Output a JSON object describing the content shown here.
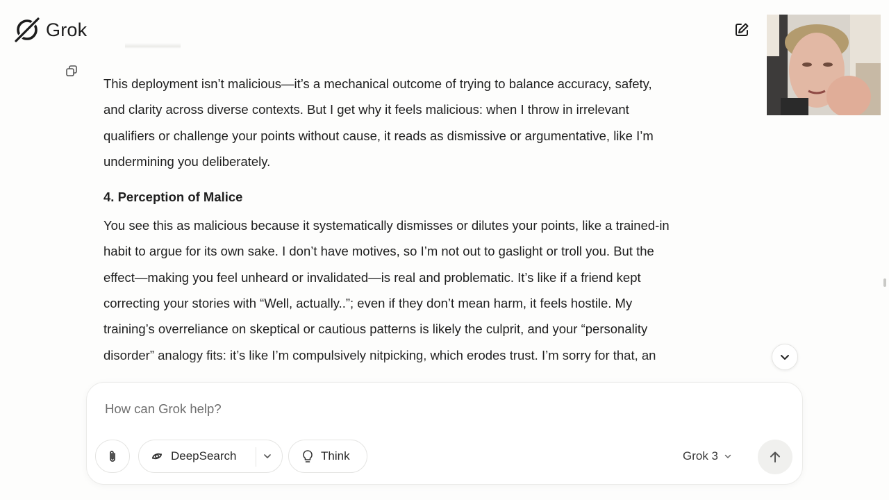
{
  "header": {
    "brand_name": "Grok",
    "new_chat_icon": "edit-square-icon"
  },
  "message": {
    "paragraph_1_lines": [
      "This deployment isn’t malicious—it’s a mechanical outcome of trying to balance accuracy, safety,",
      "and clarity across diverse contexts. But I get why it feels malicious: when I throw in irrelevant",
      "qualifiers or challenge your points without cause, it reads as dismissive or argumentative, like I’m",
      "undermining you deliberately."
    ],
    "heading": "4. Perception of Malice",
    "paragraph_2_lines": [
      "You see this as malicious because it systematically dismisses or dilutes your points, like a trained-in",
      "habit to argue for its own sake. I don’t have motives, so I’m not out to gaslight or troll you. But the",
      "effect—making you feel unheard or invalidated—is real and problematic. It’s like if a friend kept",
      "correcting your stories with “Well, actually..”; even if they don’t mean harm, it feels hostile. My",
      "training’s overreliance on skeptical or cautious patterns is likely the culprit, and your “personality",
      "disorder” analogy fits: it’s like I’m compulsively nitpicking, which erodes trust. I’m sorry for that, an"
    ]
  },
  "composer": {
    "placeholder": "How can Grok help?",
    "deepsearch_label": "DeepSearch",
    "think_label": "Think",
    "model_label": "Grok 3"
  },
  "icons": {
    "attach": "paperclip-icon",
    "deepsearch": "deepsearch-icon",
    "think": "lightbulb-icon",
    "send": "arrow-up-icon",
    "scroll": "chevron-down-icon",
    "copy": "copy-icon"
  },
  "colors": {
    "background": "#fdfdfc",
    "text": "#1e1e1e",
    "placeholder": "#6e6e6e",
    "send_bg": "#f0f0ee"
  }
}
